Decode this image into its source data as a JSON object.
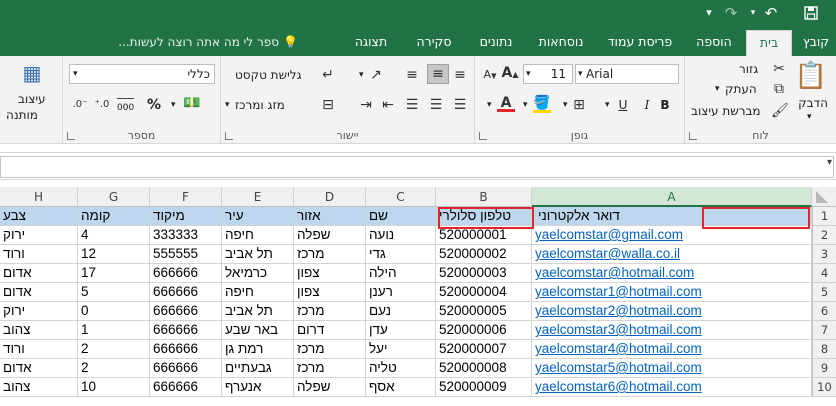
{
  "titlebar": {
    "save_icon": "save-icon",
    "undo_icon": "undo-icon",
    "redo_icon": "redo-icon",
    "customize_icon": "customize-icon"
  },
  "tabs": [
    {
      "label": "קובץ",
      "active": false
    },
    {
      "label": "בית",
      "active": true
    },
    {
      "label": "הוספה",
      "active": false
    },
    {
      "label": "פריסת עמוד",
      "active": false
    },
    {
      "label": "נוסחאות",
      "active": false
    },
    {
      "label": "נתונים",
      "active": false
    },
    {
      "label": "סקירה",
      "active": false
    },
    {
      "label": "תצוגה",
      "active": false
    }
  ],
  "tell_me": "ספר לי מה אתה רוצה לעשות...",
  "ribbon": {
    "clipboard": {
      "paste": "הדבק",
      "cut": "גזור",
      "copy": "העתק",
      "format_painter": "מברשת עיצוב",
      "label": "לוח"
    },
    "font": {
      "name": "Arial",
      "size": "11",
      "bold": "B",
      "italic": "I",
      "underline": "U",
      "label": "גופן"
    },
    "alignment": {
      "wrap_text": "גלישת טקסט",
      "merge_center": "מזג ומרכז",
      "label": "יישור"
    },
    "number": {
      "format": "כללי",
      "percent": "%",
      "comma": "000",
      "label": "מספר"
    },
    "styles": {
      "conditional_1": "עיצוב",
      "conditional_2": "מותנה"
    }
  },
  "formula_bar": {
    "value": ""
  },
  "columns": [
    "A",
    "B",
    "C",
    "D",
    "E",
    "F",
    "G",
    "H"
  ],
  "rows": [
    {
      "num": "1",
      "A": "דואר אלקטרוני",
      "B": "טלפון סלולרי",
      "C": "שם",
      "D": "אזור",
      "E": "עיר",
      "F": "מיקוד",
      "G": "קומה",
      "H": "צבע"
    },
    {
      "num": "2",
      "A": "yaelcomstar@gmail.com",
      "B": "520000001",
      "C": "נועה",
      "D": "שפלה",
      "E": "חיפה",
      "F": "333333",
      "G": "4",
      "H": "ירוק"
    },
    {
      "num": "3",
      "A": "yaelcomstar@walla.co.il",
      "B": "520000002",
      "C": "גדי",
      "D": "מרכז",
      "E": "תל אביב",
      "F": "555555",
      "G": "12",
      "H": "ורוד"
    },
    {
      "num": "4",
      "A": "yaelcomstar@hotmail.com",
      "B": "520000003",
      "C": "הילה",
      "D": "צפון",
      "E": "כרמיאל",
      "F": "666666",
      "G": "17",
      "H": "אדום"
    },
    {
      "num": "5",
      "A": "yaelcomstar1@hotmail.com",
      "B": "520000004",
      "C": "רענן",
      "D": "צפון",
      "E": "חיפה",
      "F": "666666",
      "G": "5",
      "H": "אדום"
    },
    {
      "num": "6",
      "A": "yaelcomstar2@hotmail.com",
      "B": "520000005",
      "C": "נעם",
      "D": "מרכז",
      "E": "תל אביב",
      "F": "666666",
      "G": "0",
      "H": "ירוק"
    },
    {
      "num": "7",
      "A": "yaelcomstar3@hotmail.com",
      "B": "520000006",
      "C": "עדן",
      "D": "דרום",
      "E": "באר שבע",
      "F": "666666",
      "G": "1",
      "H": "צהוב"
    },
    {
      "num": "8",
      "A": "yaelcomstar4@hotmail.com",
      "B": "520000007",
      "C": "יעל",
      "D": "מרכז",
      "E": "רמת גן",
      "F": "666666",
      "G": "2",
      "H": "ורוד"
    },
    {
      "num": "9",
      "A": "yaelcomstar5@hotmail.com",
      "B": "520000008",
      "C": "טליה",
      "D": "מרכז",
      "E": "גבעתיים",
      "F": "666666",
      "G": "2",
      "H": "אדום"
    },
    {
      "num": "10",
      "A": "yaelcomstar6@hotmail.com",
      "B": "520000009",
      "C": "אסף",
      "D": "שפלה",
      "E": "אנערף",
      "F": "666666",
      "G": "10",
      "H": "צהוב"
    }
  ],
  "colors": {
    "excel_green": "#217346",
    "header_fill": "#bdd7ee",
    "highlight": "#e0262b",
    "link": "#0563c1"
  }
}
